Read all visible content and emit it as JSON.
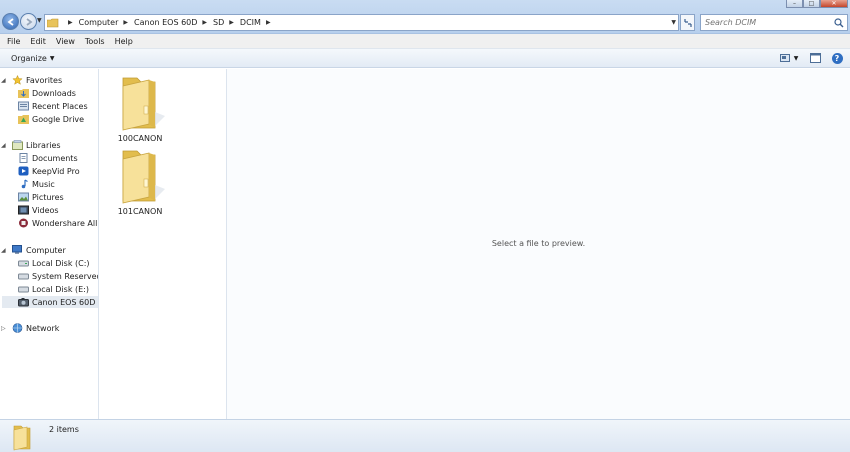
{
  "window": {
    "back_label": "Back",
    "forward_label": "Forward"
  },
  "address": {
    "breadcrumbs": [
      "Computer",
      "Canon EOS 60D",
      "SD",
      "DCIM"
    ]
  },
  "search": {
    "placeholder": "Search DCIM"
  },
  "menu": {
    "items": [
      "File",
      "Edit",
      "View",
      "Tools",
      "Help"
    ]
  },
  "toolbar": {
    "organize_label": "Organize",
    "help_label": "?"
  },
  "navigation": {
    "favorites": {
      "label": "Favorites",
      "items": [
        "Downloads",
        "Recent Places",
        "Google Drive"
      ]
    },
    "libraries": {
      "label": "Libraries",
      "items": [
        "Documents",
        "KeepVid Pro",
        "Music",
        "Pictures",
        "Videos",
        "Wondershare AllMy"
      ]
    },
    "computer": {
      "label": "Computer",
      "items": [
        "Local Disk (C:)",
        "System Reserved (D:",
        "Local Disk (E:)",
        "Canon EOS 60D"
      ]
    },
    "network": {
      "label": "Network"
    }
  },
  "files": [
    {
      "name": "100CANON"
    },
    {
      "name": "101CANON"
    }
  ],
  "preview": {
    "message": "Select a file to preview."
  },
  "status": {
    "item_count": "2 items"
  },
  "colors": {
    "folder": "#f3d772",
    "accent": "#2f6ec2"
  }
}
